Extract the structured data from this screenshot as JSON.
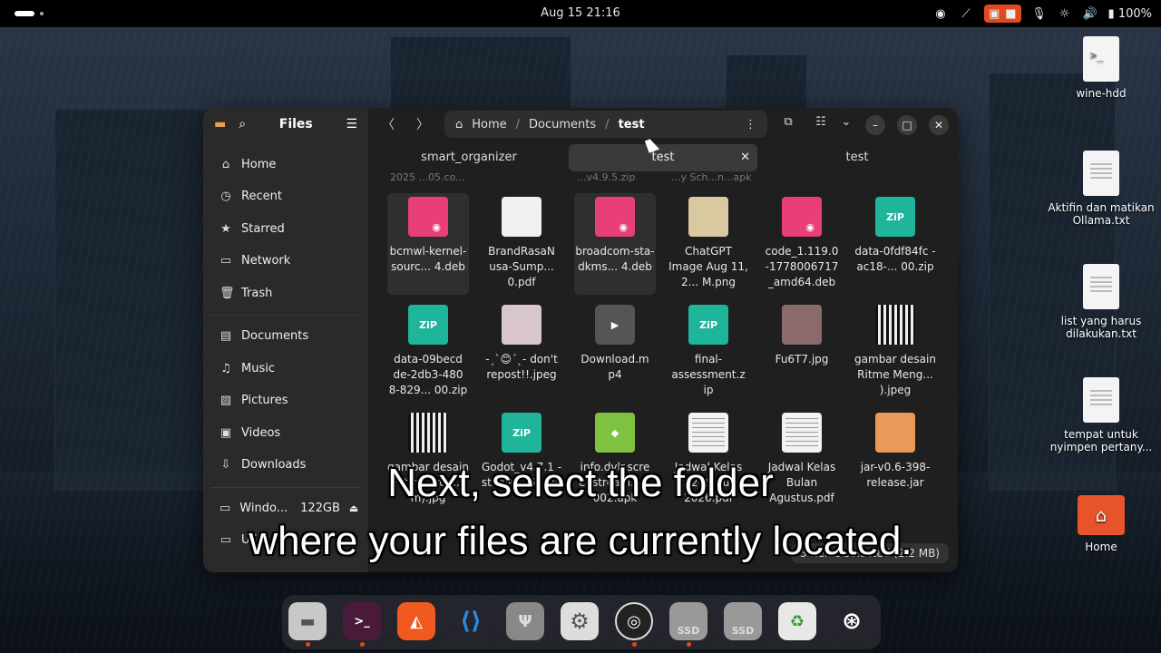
{
  "topbar": {
    "clock": "Aug 15  21:16",
    "battery": "100%",
    "icons": [
      "obs-tray-icon",
      "network-off-icon",
      "screen-record-icon",
      "microphone-icon",
      "brightness-icon",
      "volume-icon",
      "battery-icon"
    ]
  },
  "desktop": {
    "icons": [
      {
        "label": "wine-hdd",
        "icon": "terminal-file-icon"
      },
      {
        "label": "Aktifin dan matikan Ollama.txt",
        "icon": "text-file-icon"
      },
      {
        "label": "list yang harus dilakukan.txt",
        "icon": "text-file-icon"
      },
      {
        "label": "tempat untuk nyimpen pertany...",
        "icon": "text-file-icon"
      },
      {
        "label": "Home",
        "icon": "home-folder-icon"
      }
    ]
  },
  "files_window": {
    "sidebar": {
      "title": "Files",
      "items": [
        {
          "label": "Home",
          "icon": "home-icon"
        },
        {
          "label": "Recent",
          "icon": "clock-icon"
        },
        {
          "label": "Starred",
          "icon": "star-icon"
        },
        {
          "label": "Network",
          "icon": "network-icon"
        },
        {
          "label": "Trash",
          "icon": "trash-icon"
        },
        {
          "label": "Documents",
          "icon": "document-icon"
        },
        {
          "label": "Music",
          "icon": "music-icon"
        },
        {
          "label": "Pictures",
          "icon": "pictures-icon"
        },
        {
          "label": "Videos",
          "icon": "videos-icon"
        },
        {
          "label": "Downloads",
          "icon": "download-icon"
        },
        {
          "label": "Windo...",
          "size": "122GB",
          "icon": "drive-icon"
        },
        {
          "label": "USB..",
          "icon": "usb-icon"
        }
      ]
    },
    "path": [
      "Home",
      "Documents",
      "test"
    ],
    "tabs": [
      {
        "label": "smart_organizer"
      },
      {
        "label": "test",
        "active": true
      },
      {
        "label": "test"
      }
    ],
    "cut_row": [
      "2025 ...05.co...",
      "...v4.9.5.zip",
      "...y Sch...n...apk"
    ],
    "files": [
      {
        "name": "bcmwl-kernel-sourc... 4.deb",
        "type": "deb",
        "selected": true
      },
      {
        "name": "BrandRasaN usa-Sump... 0.pdf",
        "type": "pdf"
      },
      {
        "name": "broadcom-sta-dkms... 4.deb",
        "type": "deb",
        "selected": true
      },
      {
        "name": "ChatGPT Image Aug 11, 2... M.png",
        "type": "png"
      },
      {
        "name": "code_1.119.0 -1778006717 _amd64.deb",
        "type": "deb"
      },
      {
        "name": "data-0fdf84fc - ac18-... 00.zip",
        "type": "zip"
      },
      {
        "name": "data-09becd de-2db3-480 8-829... 00.zip",
        "type": "zip"
      },
      {
        "name": "-ˏˋ😊ˊˎ- don't repost!!.jpeg",
        "type": "img2"
      },
      {
        "name": "Download.m p4",
        "type": "mp4"
      },
      {
        "name": "final-assessment.z ip",
        "type": "zip"
      },
      {
        "name": "Fu6T7.jpg",
        "type": "img"
      },
      {
        "name": "gambar desain Ritme Meng... ).jpeg",
        "type": "stripes"
      },
      {
        "name": "gambar desain Ritme Prog... m).jpg",
        "type": "stripes"
      },
      {
        "name": "Godot_v4.7.1 -stable... 64.zip",
        "type": "zip"
      },
      {
        "name": "info.dvlr.scre enstream.4... 002.apk",
        "type": "apk"
      },
      {
        "name": "Jadwal Kelas 12-2... ul 2026.pdf",
        "type": "sheet"
      },
      {
        "name": "Jadwal Kelas Bulan Agustus.pdf",
        "type": "sheet"
      },
      {
        "name": "jar-v0.6-398-release.jar",
        "type": "jar"
      }
    ],
    "status": "3 items selected (2.2 MB)"
  },
  "dock": {
    "apps": [
      "files-icon",
      "terminal-icon",
      "brave-icon",
      "vscode-icon",
      "usb-writer-icon",
      "settings-icon",
      "obs-icon",
      "ssd-drive-icon",
      "ssd-drive-icon",
      "trash-bin-icon",
      "ubuntu-apps-icon"
    ],
    "ssd_label": "SSD"
  },
  "subtitle": {
    "line1": "Next, select the folder",
    "line2": "where your files are currently located."
  }
}
